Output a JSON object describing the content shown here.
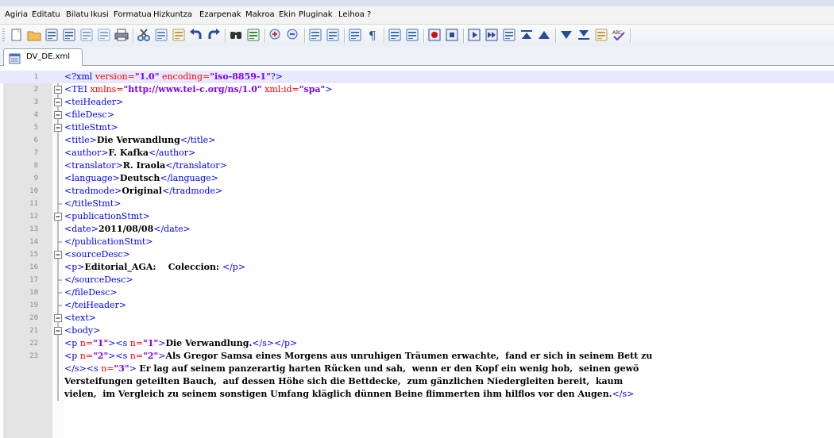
{
  "menu": [
    "Agiria",
    "Editatu",
    "Bilatu",
    "Ikusi",
    "Formatua",
    "Hizkuntza",
    "Ezarpenak",
    "Makroa",
    "Ekin",
    "Pluginak",
    "Leihoa",
    "?"
  ],
  "toolbar": {
    "buttons": [
      {
        "name": "new-file-icon",
        "color": "#ffffff"
      },
      {
        "name": "open-file-icon",
        "color": "#f2b33d"
      },
      {
        "name": "save-icon",
        "color": "#4a6fb5"
      },
      {
        "name": "save-all-icon",
        "color": "#4a6fb5"
      },
      {
        "name": "close-file-icon",
        "color": "#8aa6d6"
      },
      {
        "name": "close-all-icon",
        "color": "#8aa6d6"
      },
      {
        "name": "print-icon",
        "color": "#6a6a8a"
      },
      {
        "name": "cut-icon",
        "color": "#3a6fc0"
      },
      {
        "name": "copy-icon",
        "color": "#5a8ad6"
      },
      {
        "name": "paste-icon",
        "color": "#c49a3a"
      },
      {
        "name": "undo-icon",
        "color": "#2a4c96"
      },
      {
        "name": "redo-icon",
        "color": "#2a4c96"
      },
      {
        "name": "find-icon",
        "color": "#333333"
      },
      {
        "name": "replace-icon",
        "color": "#3a8a3a"
      },
      {
        "name": "zoom-in-icon",
        "color": "#d03030"
      },
      {
        "name": "zoom-out-icon",
        "color": "#3060d0"
      },
      {
        "name": "sync-vertical-icon",
        "color": "#4a7ac0"
      },
      {
        "name": "sync-horizontal-icon",
        "color": "#4a7ac0"
      },
      {
        "name": "word-wrap-icon",
        "color": "#3a6fc0"
      },
      {
        "name": "show-all-chars-icon",
        "color": "#2a4c96"
      },
      {
        "name": "indent-guide-icon",
        "color": "#3a6fc0"
      },
      {
        "name": "doc-map-icon",
        "color": "#3a6fc0"
      },
      {
        "name": "record-macro-icon",
        "color": "#cc1111"
      },
      {
        "name": "stop-record-icon",
        "color": "#2a4c96"
      },
      {
        "name": "playback-macro-icon",
        "color": "#2a4c96"
      },
      {
        "name": "run-macro-multiple-icon",
        "color": "#2a4c96"
      },
      {
        "name": "save-macro-icon",
        "color": "#4a6fb5"
      },
      {
        "name": "collapse-icon",
        "color": "#2a4c96"
      },
      {
        "name": "prev-icon",
        "color": "#2a4c96"
      },
      {
        "name": "next-icon",
        "color": "#2a4c96"
      },
      {
        "name": "expand-icon",
        "color": "#2a4c96"
      },
      {
        "name": "tag-icon",
        "color": "#c49a3a"
      },
      {
        "name": "spellcheck-icon",
        "color": "#7a3ac0"
      }
    ]
  },
  "tab": {
    "label": "DV_DE.xml"
  },
  "lines": [
    {
      "n": "1",
      "fold": "none",
      "current": true,
      "segs": [
        [
          "t",
          "<?xml "
        ],
        [
          "a",
          "version="
        ],
        [
          "v",
          "\"1.0\""
        ],
        [
          "a",
          " encoding="
        ],
        [
          "v",
          "\"iso-8859-1\""
        ],
        [
          "t",
          "?>"
        ]
      ]
    },
    {
      "n": "2",
      "fold": "open",
      "segs": [
        [
          "t",
          "<TEI "
        ],
        [
          "a",
          "xmlns="
        ],
        [
          "v",
          "\"http://www.tei-c.org/ns/1.0\""
        ],
        [
          "a",
          " xml:id="
        ],
        [
          "v",
          "\"spa\""
        ],
        [
          "t",
          ">"
        ]
      ]
    },
    {
      "n": "3",
      "fold": "open",
      "segs": [
        [
          "t",
          "<teiHeader>"
        ]
      ]
    },
    {
      "n": "4",
      "fold": "open",
      "segs": [
        [
          "t",
          "<fileDesc>"
        ]
      ]
    },
    {
      "n": "5",
      "fold": "open",
      "segs": [
        [
          "t",
          "<titleStmt>"
        ]
      ]
    },
    {
      "n": "6",
      "fold": "line",
      "segs": [
        [
          "t",
          "<title>"
        ],
        [
          "b",
          "Die Verwandlung"
        ],
        [
          "t",
          "</title>"
        ]
      ]
    },
    {
      "n": "7",
      "fold": "line",
      "segs": [
        [
          "t",
          "<author>"
        ],
        [
          "b",
          "F. Kafka"
        ],
        [
          "t",
          "</author>"
        ]
      ]
    },
    {
      "n": "8",
      "fold": "line",
      "segs": [
        [
          "t",
          "<translator>"
        ],
        [
          "b",
          "R. Iraola"
        ],
        [
          "t",
          "</translator>"
        ]
      ]
    },
    {
      "n": "9",
      "fold": "line",
      "segs": [
        [
          "t",
          "<language>"
        ],
        [
          "b",
          "Deutsch"
        ],
        [
          "t",
          "</language>"
        ]
      ]
    },
    {
      "n": "10",
      "fold": "line",
      "segs": [
        [
          "t",
          "<tradmode>"
        ],
        [
          "b",
          "Original"
        ],
        [
          "t",
          "</tradmode>"
        ]
      ]
    },
    {
      "n": "11",
      "fold": "end",
      "segs": [
        [
          "t",
          "</titleStmt>"
        ]
      ]
    },
    {
      "n": "12",
      "fold": "open",
      "segs": [
        [
          "t",
          "<publicationStmt>"
        ]
      ]
    },
    {
      "n": "13",
      "fold": "line",
      "segs": [
        [
          "t",
          "<date>"
        ],
        [
          "b",
          "2011/08/08"
        ],
        [
          "t",
          "</date>"
        ]
      ]
    },
    {
      "n": "14",
      "fold": "end",
      "segs": [
        [
          "t",
          "</publicationStmt>"
        ]
      ]
    },
    {
      "n": "15",
      "fold": "open",
      "segs": [
        [
          "t",
          "<sourceDesc>"
        ]
      ]
    },
    {
      "n": "16",
      "fold": "line",
      "segs": [
        [
          "t",
          "<p>"
        ],
        [
          "b",
          "Editorial_AGA:    Coleccion: "
        ],
        [
          "t",
          "</p>"
        ]
      ]
    },
    {
      "n": "17",
      "fold": "end",
      "segs": [
        [
          "t",
          "</sourceDesc>"
        ]
      ]
    },
    {
      "n": "18",
      "fold": "end",
      "segs": [
        [
          "t",
          "</fileDesc>"
        ]
      ]
    },
    {
      "n": "19",
      "fold": "end",
      "segs": [
        [
          "t",
          "</teiHeader>"
        ]
      ]
    },
    {
      "n": "20",
      "fold": "open",
      "segs": [
        [
          "t",
          "<text>"
        ]
      ]
    },
    {
      "n": "21",
      "fold": "open",
      "segs": [
        [
          "t",
          "<body>"
        ]
      ]
    },
    {
      "n": "22",
      "fold": "line",
      "segs": [
        [
          "t",
          "<p "
        ],
        [
          "a",
          "n="
        ],
        [
          "v",
          "\"1\""
        ],
        [
          "t",
          "><s "
        ],
        [
          "a",
          "n="
        ],
        [
          "v",
          "\"1\""
        ],
        [
          "t",
          ">"
        ],
        [
          "b",
          "Die Verwandlung."
        ],
        [
          "t",
          "</s></p>"
        ]
      ]
    },
    {
      "n": "23",
      "fold": "line",
      "segs": [
        [
          "t",
          "<p "
        ],
        [
          "a",
          "n="
        ],
        [
          "v",
          "\"2\""
        ],
        [
          "t",
          "><s "
        ],
        [
          "a",
          "n="
        ],
        [
          "v",
          "\"2\""
        ],
        [
          "t",
          ">"
        ],
        [
          "b",
          "Als Gregor Samsa eines Morgens aus unruhigen Träumen erwachte,  fand er sich in seinem Bett zu"
        ]
      ]
    },
    {
      "n": "",
      "fold": "line",
      "segs": [
        [
          "t",
          "</s><s "
        ],
        [
          "a",
          "n="
        ],
        [
          "v",
          "\"3\""
        ],
        [
          "t",
          "> "
        ],
        [
          "b",
          "Er lag auf seinem panzerartig harten Rücken und sah,  wenn er den Kopf ein wenig hob,  seinen gewö"
        ]
      ]
    },
    {
      "n": "",
      "fold": "line",
      "segs": [
        [
          "b",
          "Versteifungen geteilten Bauch,  auf dessen Höhe sich die Bettdecke,  zum gänzlichen Niedergleiten bereit,  kaum"
        ]
      ]
    },
    {
      "n": "",
      "fold": "line",
      "segs": [
        [
          "b",
          "vielen,  im Vergleich zu seinem sonstigen Umfang kläglich dünnen Beine flimmerten ihm hilflos vor den Augen."
        ],
        [
          "t",
          "</s>"
        ]
      ]
    }
  ]
}
